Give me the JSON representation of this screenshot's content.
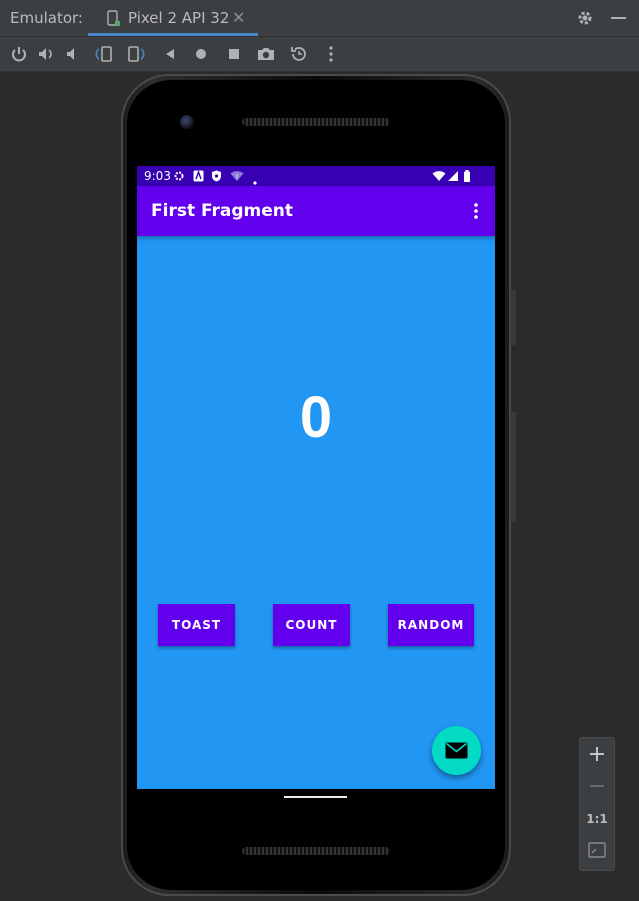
{
  "window": {
    "label": "Emulator:",
    "tab_label": "Pixel 2 API 32",
    "tab_close": "✕"
  },
  "toolbar": {
    "icons": [
      "power-icon",
      "volume-up-icon",
      "volume-down-icon",
      "rotate-left-icon",
      "rotate-right-icon",
      "back-icon",
      "home-icon",
      "overview-icon",
      "screenshot-icon",
      "snapshot-icon",
      "more-icon"
    ]
  },
  "device": {
    "status_bar": {
      "time": "9:03"
    },
    "app_bar": {
      "title": "First Fragment"
    },
    "count_value": "0",
    "buttons": {
      "toast": "TOAST",
      "count": "COUNT",
      "random": "RANDOM"
    },
    "colors": {
      "background": "#2196f3",
      "primary": "#6200ee",
      "primary_dark": "#3700b3",
      "fab": "#03dac5"
    }
  },
  "zoom": {
    "plus": "+",
    "minus": "−",
    "actual_size": "1:1"
  }
}
